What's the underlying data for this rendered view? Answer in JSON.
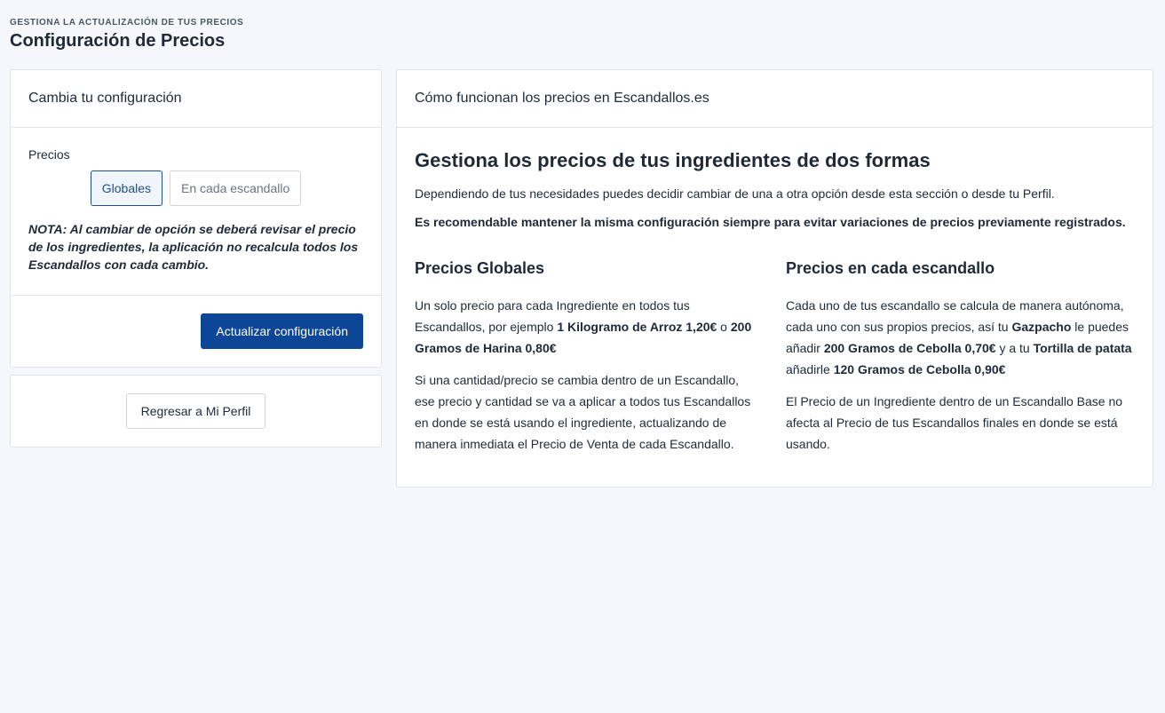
{
  "header": {
    "pretitle": "GESTIONA LA ACTUALIZACIÓN DE TUS PRECIOS",
    "title": "Configuración de Precios"
  },
  "config_card": {
    "title": "Cambia tu configuración",
    "prices_label": "Precios",
    "options": [
      "Globales",
      "En cada escandallo"
    ],
    "selected_option": "Globales",
    "note": "NOTA: Al cambiar de opción se deberá revisar el precio de los ingredientes, la aplicación no recalcula todos los Escandallos con cada cambio.",
    "update_button": "Actualizar configuración"
  },
  "back_card": {
    "back_button": "Regresar a Mi Perfil"
  },
  "info_card": {
    "header": "Cómo funcionan los precios en Escandallos.es",
    "title": "Gestiona los precios de tus ingredientes de dos formas",
    "intro": "Dependiendo de tus necesidades puedes decidir cambiar de una a otra opción desde esta sección o desde tu Perfil.",
    "recommendation": "Es recomendable mantener la misma configuración siempre para evitar variaciones de precios previamente registrados.",
    "global": {
      "title": "Precios Globales",
      "p1_a": "Un solo precio para cada Ingrediente en todos tus Escandallos, por ejemplo ",
      "p1_b": "1 Kilogramo de Arroz 1,20€",
      "p1_c": " o ",
      "p1_d": "200 Gramos de Harina 0,80€",
      "p2": "Si una cantidad/precio se cambia dentro de un Escandallo, ese precio y cantidad se va a aplicar a todos tus Escandallos en donde se está usando el ingrediente, actualizando de manera inmediata el Precio de Venta de cada Escandallo."
    },
    "per_recipe": {
      "title": "Precios en cada escandallo",
      "p1_a": "Cada uno de tus escandallo se calcula de manera autónoma, cada uno con sus propios precios, así tu ",
      "p1_b": "Gazpacho",
      "p1_c": " le puedes añadir ",
      "p1_d": "200 Gramos de Cebolla 0,70€",
      "p1_e": " y a tu ",
      "p1_f": "Tortilla de patata",
      "p1_g": " añadirle ",
      "p1_h": "120 Gramos de Cebolla 0,90€",
      "p2": "El Precio de un Ingrediente dentro de un Escandallo Base no afecta al Precio de tus Escandallos finales en donde se está usando."
    }
  }
}
